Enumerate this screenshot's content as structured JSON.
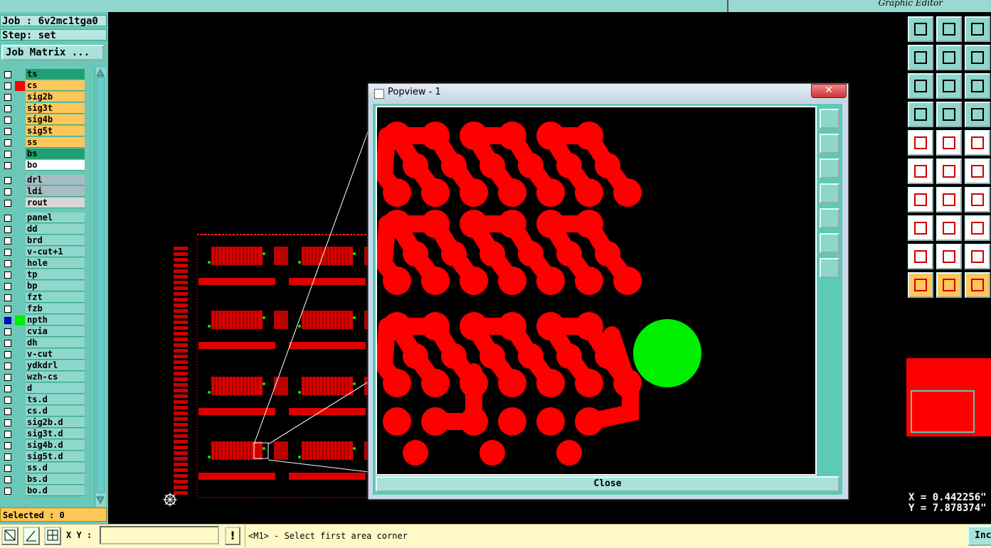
{
  "app": {
    "subtitle": "Graphic Editor"
  },
  "job": {
    "job_label": "Job : 6v2mc1tga0",
    "step_label": "Step: set",
    "matrix_button": "Job Matrix ..."
  },
  "layers": [
    {
      "name": "ts",
      "bg": "#20a070",
      "sw": ""
    },
    {
      "name": "cs",
      "bg": "#ffc65a",
      "sw": "#ff0000"
    },
    {
      "name": "sig2b",
      "bg": "#ffc65a",
      "sw": ""
    },
    {
      "name": "sig3t",
      "bg": "#ffc65a",
      "sw": ""
    },
    {
      "name": "sig4b",
      "bg": "#ffc65a",
      "sw": ""
    },
    {
      "name": "sig5t",
      "bg": "#ffc65a",
      "sw": ""
    },
    {
      "name": "ss",
      "bg": "#ffc65a",
      "sw": ""
    },
    {
      "name": "bs",
      "bg": "#20a070",
      "sw": ""
    },
    {
      "name": "bo",
      "bg": "#ffffff",
      "sw": ""
    },
    {
      "name": "drl",
      "bg": "#a9bcc4",
      "sw": "",
      "gap": true
    },
    {
      "name": "ldi",
      "bg": "#a9bcc4",
      "sw": ""
    },
    {
      "name": "rout",
      "bg": "#d8d8d8",
      "sw": ""
    },
    {
      "name": "panel",
      "bg": "#8fd6cc",
      "sw": "",
      "gap": true
    },
    {
      "name": "dd",
      "bg": "#8fd6cc",
      "sw": ""
    },
    {
      "name": "brd",
      "bg": "#8fd6cc",
      "sw": ""
    },
    {
      "name": "v-cut+1",
      "bg": "#8fd6cc",
      "sw": ""
    },
    {
      "name": "hole",
      "bg": "#8fd6cc",
      "sw": ""
    },
    {
      "name": "tp",
      "bg": "#8fd6cc",
      "sw": ""
    },
    {
      "name": "bp",
      "bg": "#8fd6cc",
      "sw": ""
    },
    {
      "name": "fzt",
      "bg": "#8fd6cc",
      "sw": ""
    },
    {
      "name": "fzb",
      "bg": "#8fd6cc",
      "sw": ""
    },
    {
      "name": "npth",
      "bg": "#8fd6cc",
      "sw": "#00ee00",
      "active": true
    },
    {
      "name": "cvia",
      "bg": "#8fd6cc",
      "sw": ""
    },
    {
      "name": "dh",
      "bg": "#8fd6cc",
      "sw": ""
    },
    {
      "name": "v-cut",
      "bg": "#8fd6cc",
      "sw": ""
    },
    {
      "name": "ydkdrl",
      "bg": "#8fd6cc",
      "sw": ""
    },
    {
      "name": "wzh-cs",
      "bg": "#8fd6cc",
      "sw": ""
    },
    {
      "name": "d",
      "bg": "#8fd6cc",
      "sw": ""
    },
    {
      "name": "ts.d",
      "bg": "#8fd6cc",
      "sw": ""
    },
    {
      "name": "cs.d",
      "bg": "#8fd6cc",
      "sw": ""
    },
    {
      "name": "sig2b.d",
      "bg": "#8fd6cc",
      "sw": ""
    },
    {
      "name": "sig3t.d",
      "bg": "#8fd6cc",
      "sw": ""
    },
    {
      "name": "sig4b.d",
      "bg": "#8fd6cc",
      "sw": ""
    },
    {
      "name": "sig5t.d",
      "bg": "#8fd6cc",
      "sw": ""
    },
    {
      "name": "ss.d",
      "bg": "#8fd6cc",
      "sw": ""
    },
    {
      "name": "bs.d",
      "bg": "#8fd6cc",
      "sw": ""
    },
    {
      "name": "bo.d",
      "bg": "#8fd6cc",
      "sw": ""
    }
  ],
  "selected": "Selected : 0",
  "popup": {
    "title": "Popview - 1",
    "close_label": "Close"
  },
  "coords": {
    "x": "X = 0.442256\"",
    "y": "Y = 7.878374\""
  },
  "bottom": {
    "xy_label": "X Y :",
    "xy_value": "",
    "warn": "!",
    "status": "<M1> - Select first area corner",
    "inc": "Inc"
  },
  "colors": {
    "trace": "#ff0000",
    "pad": "#00ee00",
    "panel": "#8fd6cc"
  }
}
